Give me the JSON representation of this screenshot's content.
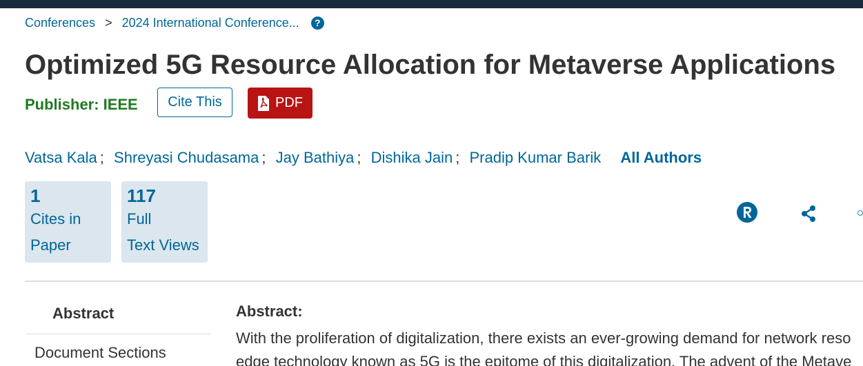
{
  "breadcrumb": {
    "items": [
      "Conferences",
      "2024 International Conference..."
    ],
    "separator": ">"
  },
  "title": "Optimized 5G Resource Allocation for Metaverse Applications",
  "publisher": {
    "label": "Publisher:",
    "name": "IEEE"
  },
  "actions": {
    "cite": "Cite This",
    "pdf": "PDF"
  },
  "authors": {
    "names": [
      "Vatsa Kala",
      "Shreyasi Chudasama",
      "Jay Bathiya",
      "Dishika Jain",
      "Pradip Kumar Barik"
    ],
    "all_label": "All Authors"
  },
  "metrics": [
    {
      "value": "1",
      "line1": "Cites in",
      "line2": "Paper"
    },
    {
      "value": "117",
      "line1": "Full",
      "line2": "Text Views"
    }
  ],
  "icons": [
    "help-icon",
    "pdf-icon",
    "rights-icon",
    "share-icon",
    "alert-icon"
  ],
  "sidebar": {
    "active": "Abstract",
    "sections": "Document Sections"
  },
  "abstract": {
    "heading": "Abstract:",
    "line1": "With the proliferation of digitalization, there exists an ever-growing demand for network reso",
    "line2": "edge technology known as 5G is the epitome of this digitalization. The advent of the Metave"
  },
  "colors": {
    "link": "#006699",
    "publisher": "#1e7a1e",
    "pdf": "#b81414",
    "topbar": "#182a3e",
    "metric_bg": "#dbe6ee"
  }
}
